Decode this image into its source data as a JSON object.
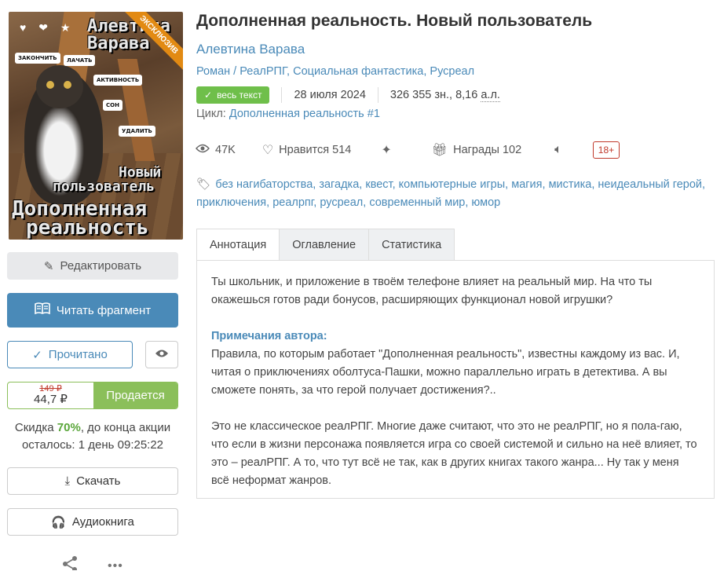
{
  "cover": {
    "ribbon": "ЭКСКЛЮЗИВ",
    "author_line": "Алевтина Варава",
    "title_line1": "Новый",
    "title_line2": "пользователь",
    "title_line3": "Дополненная",
    "title_line4": "реальность",
    "tags": [
      "ЗАКОНЧИТЬ",
      "ЛАЧАТЬ",
      "АКТИВНОСТЬ",
      "СОН",
      "УДАЛИТЬ"
    ]
  },
  "book": {
    "title": "Дополненная реальность. Новый пользователь",
    "author": "Алевтина Варава",
    "form": "Роман",
    "genres": [
      "РеалРПГ",
      "Социальная фантастика",
      "Русреал"
    ],
    "status": "весь текст",
    "date": "28 июля 2024",
    "size_chars": "326 355 зн.,",
    "size_al": "8,16",
    "size_al_unit": "а.л.",
    "cycle_label": "Цикл:",
    "cycle_name": "Дополненная реальность #1"
  },
  "stats": {
    "views": "47K",
    "likes_label": "Нравится",
    "likes": "514",
    "awards_label": "Награды",
    "awards": "102",
    "age": "18+"
  },
  "tags": [
    "без нагибаторства",
    "загадка",
    "квест",
    "компьютерные игры",
    "магия",
    "мистика",
    "неидеальный герой",
    "приключения",
    "реалрпг",
    "русреал",
    "современный мир",
    "юмор"
  ],
  "tabs": [
    "Аннотация",
    "Оглавление",
    "Статистика"
  ],
  "annotation": {
    "p1": "Ты школьник, и приложение в твоём телефоне влияет на реальный мир. На что ты окажешься готов ради бонусов, расширяющих функционал новой игрушки?",
    "notes_header": "Примечания автора:",
    "p2": "Правила, по которым работает \"Дополненная реальность\", известны каждому из вас. И, читая о приключениях оболтуса-Пашки, можно параллельно играть в детектива. А вы сможете понять, за что герой получает достижения?..",
    "p3": "Это не классическое реалРПГ. Многие даже считают, что это не реалРПГ, но я пола-гаю, что если в жизни персонажа появляется игра со своей системой и сильно на неё влияет, то это – реалРПГ. А то, что тут всё не так, как в других книгах такого жанра... Ну так у меня всё неформат жанров."
  },
  "sidebar": {
    "edit_label": "Редактировать",
    "read_label": "Читать фрагмент",
    "done_label": "Прочитано",
    "old_price": "149 ₽",
    "new_price": "44,7 ₽",
    "sale_label": "Продается",
    "discount_prefix": "Скидка",
    "discount_pct": "70%",
    "discount_suffix": ", до конца акции",
    "discount_remaining": "осталось: 1 день 09:25:22",
    "download_label": "Скачать",
    "audio_label": "Аудиокнига"
  },
  "colors": {
    "accent": "#4a8ab8",
    "green": "#8bbf5a",
    "badge": "#6fbf4a",
    "ribbon": "#e28a13",
    "age": "#c0392b"
  }
}
